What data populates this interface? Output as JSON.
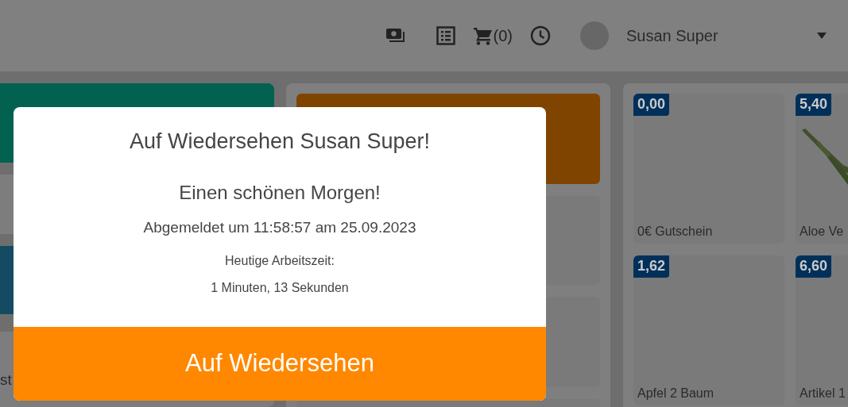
{
  "header": {
    "cart_count": "(0)",
    "user_name": "Susan Super"
  },
  "left_tiles": [
    {
      "color": "#02614f"
    },
    {
      "color": "#7d7d7d"
    },
    {
      "color": "#154a63"
    },
    {
      "color": "#7d7d7d",
      "label": "st"
    }
  ],
  "middle_tiles": [
    {
      "color": "#7f4500"
    },
    {
      "color": "#7a7a7a"
    },
    {
      "color": "#7a7a7a"
    },
    {
      "color": "#7a7a7a"
    }
  ],
  "products": [
    {
      "price": "0,00",
      "name": "0€ Gutschein",
      "kind": "plain"
    },
    {
      "price": "5,40",
      "name": "Aloe Ve",
      "kind": "picture"
    },
    {
      "price": "1,62",
      "name": "Apfel 2 Baum",
      "kind": "plain"
    },
    {
      "price": "6,60",
      "name": "Artikel 1",
      "kind": "plain"
    }
  ],
  "modal": {
    "title": "Auf Wiedersehen Susan Super!",
    "greeting": "Einen schönen Morgen!",
    "logout_line": "Abgemeldet um 11:58:57 am 25.09.2023",
    "worktime_label": "Heutige Arbeitszeit:",
    "worktime_value": "1 Minuten, 13 Sekunden",
    "button": "Auf Wiedersehen"
  }
}
